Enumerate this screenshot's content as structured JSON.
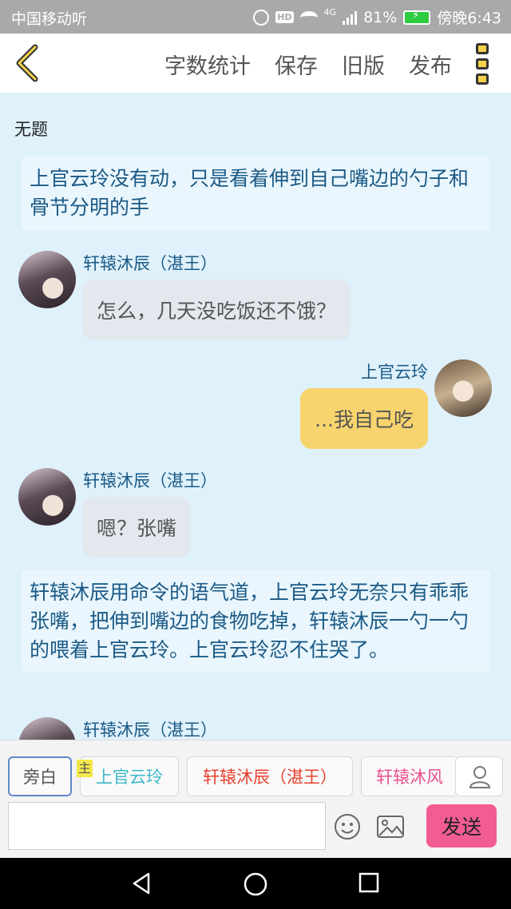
{
  "status_bar": {
    "carrier": "中国移动听",
    "hd_label": "HD",
    "network": "4G",
    "battery": "81%",
    "time": "傍晚6:43"
  },
  "nav": {
    "links": [
      "字数统计",
      "保存",
      "旧版",
      "发布"
    ],
    "icons": [
      "back-chevron-icon",
      "more-vert-icon"
    ]
  },
  "document": {
    "title": "无题"
  },
  "messages": [
    {
      "type": "narration",
      "text": "上官云玲没有动，只是看着伸到自己嘴边的勺子和骨节分明的手"
    },
    {
      "type": "dialogue",
      "side": "left",
      "name": "轩辕沐辰（湛王）",
      "text": "怎么，几天没吃饭还不饿？"
    },
    {
      "type": "dialogue",
      "side": "right",
      "name": "上官云玲",
      "text": "...我自己吃"
    },
    {
      "type": "dialogue",
      "side": "left",
      "name": "轩辕沐辰（湛王）",
      "text": "嗯？张嘴"
    },
    {
      "type": "narration",
      "text": "轩辕沐辰用命令的语气道，上官云玲无奈只有乖乖张嘴，把伸到嘴边的食物吃掉，轩辕沐辰一勺一勺的喂着上官云玲。上官云玲忍不住哭了。"
    },
    {
      "type": "dialogue",
      "side": "left",
      "name": "轩辕沐辰（湛王）",
      "text": ""
    }
  ],
  "roles": [
    {
      "label": "旁白",
      "color": "#555555",
      "selected": true
    },
    {
      "label": "上官云玲",
      "color": "#3fb8c9",
      "selected": false
    },
    {
      "label": "轩辕沐辰（湛王）",
      "color": "#e8412f",
      "selected": false
    },
    {
      "label": "轩辕沐风",
      "color": "#e8508f",
      "selected": false
    }
  ],
  "host_badge": "主",
  "composer": {
    "placeholder": "",
    "send_label": "发送"
  },
  "colors": {
    "accent_pink": "#f25c93",
    "bubble_yellow": "#f8d46e",
    "chat_bg": "#dff1fb",
    "narration_text": "#1b5a86"
  }
}
